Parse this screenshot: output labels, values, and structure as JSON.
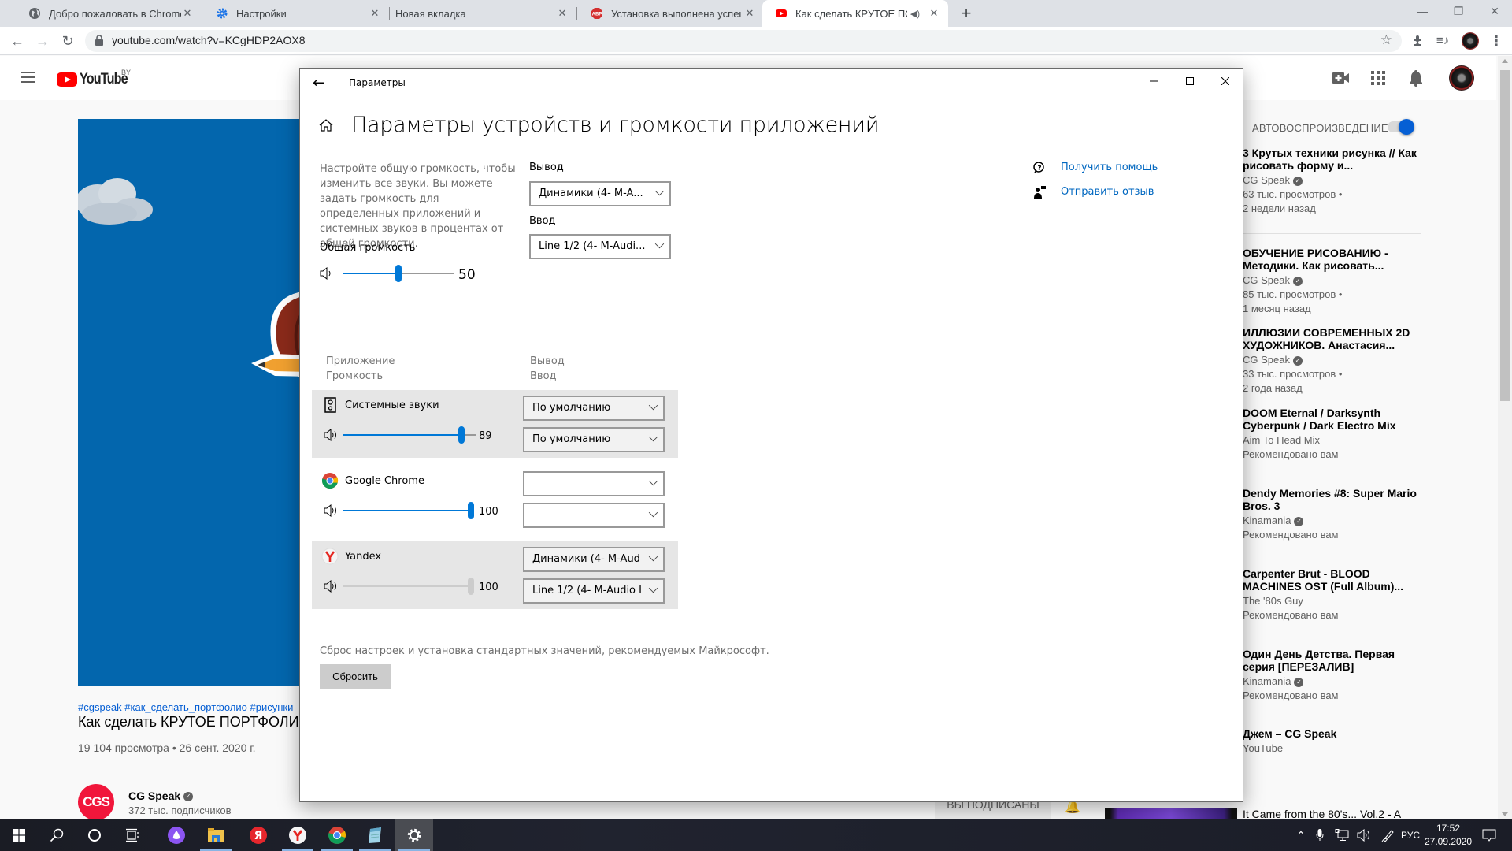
{
  "browser": {
    "tabs": [
      {
        "title": "Добро пожаловать в Chrome!",
        "icon": "globe-icon",
        "active": false
      },
      {
        "title": "Настройки",
        "icon": "gear-icon",
        "active": false
      },
      {
        "title": "Новая вкладка",
        "icon": "none",
        "active": false
      },
      {
        "title": "Установка выполнена успешно!",
        "icon": "adblock-icon",
        "active": false
      },
      {
        "title": "Как сделать КРУТОЕ ПОРТФ",
        "icon": "youtube-icon",
        "active": true,
        "audio": true
      }
    ],
    "new_tab_label": "+",
    "url": "youtube.com/watch?v=KCgHDP2AOX8"
  },
  "youtube": {
    "logo_text": "YouTube",
    "country_code": "BY",
    "video": {
      "hashtags": "#cgspeak #как_сделать_портфолио #рисунки",
      "title": "Как сделать КРУТОЕ ПОРТФОЛИО",
      "meta": "19 104 просмотра • 26 сент. 2020 г."
    },
    "channel": {
      "avatar_text": "CGS",
      "name": "CG Speak",
      "subscribers": "372 тыс. подписчиков",
      "subscribed_label": "ВЫ ПОДПИСАНЫ"
    },
    "autoplay_label": "АВТОВОСПРОИЗВЕДЕНИЕ",
    "autoplay_on": true,
    "recommendations": [
      {
        "title": "3 Крутых техники рисунка // Как рисовать форму и...",
        "channel": "CG Speak",
        "verified": true,
        "views": "63 тыс. просмотров •",
        "age": "2 недели назад"
      },
      {
        "title": "ОБУЧЕНИЕ РИСОВАНИЮ - Методики. Как рисовать...",
        "channel": "CG Speak",
        "verified": true,
        "views": "85 тыс. просмотров •",
        "age": "1 месяц назад"
      },
      {
        "title": "ИЛЛЮЗИИ СОВРЕМЕННЫХ 2D ХУДОЖНИКОВ. Анастасия...",
        "channel": "CG Speak",
        "verified": true,
        "views": "33 тыс. просмотров •",
        "age": "2 года назад"
      },
      {
        "title": "DOOM Eternal / Darksynth Cyberpunk / Dark Electro Mix",
        "channel": "Aim To Head Mix",
        "verified": false,
        "views": "Рекомендовано вам",
        "age": ""
      },
      {
        "title": "Dendy Memories #8: Super Mario Bros. 3",
        "channel": "Kinamania",
        "verified": true,
        "views": "Рекомендовано вам",
        "age": ""
      },
      {
        "title": "Carpenter Brut - BLOOD MACHINES OST (Full Album)...",
        "channel": "The '80s Guy",
        "verified": false,
        "views": "Рекомендовано вам",
        "age": ""
      },
      {
        "title": "Один День Детства. Первая серия [ПЕРЕЗАЛИВ]",
        "channel": "Kinamania",
        "verified": true,
        "views": "Рекомендовано вам",
        "age": ""
      },
      {
        "title": "Джем – CG Speak",
        "channel": "YouTube",
        "verified": false,
        "views": "",
        "age": ""
      },
      {
        "title": "It Came from the 80's... Vol.2 - A",
        "channel": "",
        "verified": false,
        "views": "",
        "age": ""
      }
    ]
  },
  "settings": {
    "window_title": "Параметры",
    "heading": "Параметры устройств и громкости приложений",
    "description": "Настройте общую громкость, чтобы изменить все звуки. Вы можете задать громкость для определенных приложений и системных звуков в процентах от общей громкости.",
    "master_volume_label": "Общая громкость",
    "master_volume": 50,
    "output_label": "Вывод",
    "output_value": "Динамики (4- M-A...",
    "input_label": "Ввод",
    "input_value": "Line 1/2 (4- M-Audi...",
    "col_app": "Приложение",
    "col_volume": "Громкость",
    "col_output": "Вывод",
    "col_input": "Ввод",
    "apps": [
      {
        "name": "Системные звуки",
        "icon": "system-sounds-icon",
        "volume": 89,
        "enabled": true,
        "output": "По умолчанию",
        "input": "По умолчанию"
      },
      {
        "name": "Google Chrome",
        "icon": "chrome-icon",
        "volume": 100,
        "enabled": true,
        "output": "",
        "input": ""
      },
      {
        "name": "Yandex",
        "icon": "yandex-icon",
        "volume": 100,
        "enabled": false,
        "output": "Динамики (4- M-Aud",
        "input": "Line 1/2 (4- M-Audio I"
      }
    ],
    "reset_description": "Сброс настроек и установка стандартных значений, рекомендуемых Майкрософт.",
    "reset_button": "Сбросить",
    "help_links": [
      "Получить помощь",
      "Отправить отзыв"
    ]
  },
  "taskbar": {
    "language": "РУС",
    "time": "17:52",
    "date": "27.09.2020"
  },
  "colors": {
    "accent": "#0078d7",
    "link": "#0067c0",
    "youtube_red": "#ff0000"
  }
}
